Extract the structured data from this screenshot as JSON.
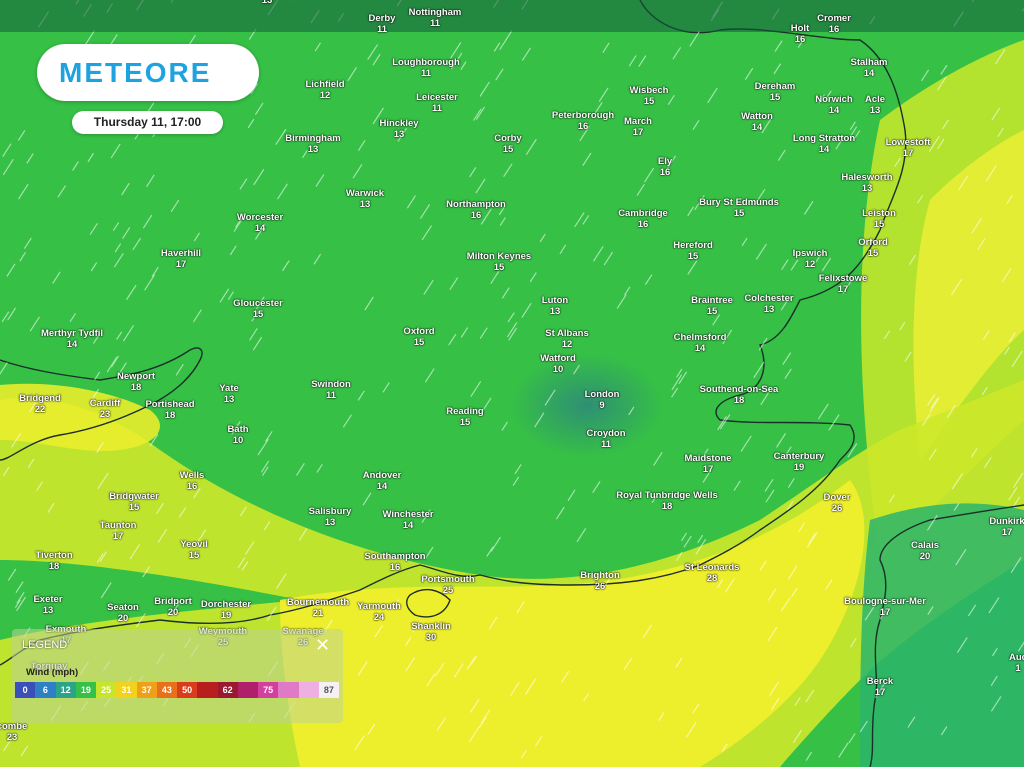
{
  "brand": {
    "logo_text": "METEORE"
  },
  "forecast": {
    "time_label": "Thursday 11, 17:00"
  },
  "legend": {
    "title": "LEGEND",
    "unit_label": "Wind (mph)",
    "close_icon": "close-icon",
    "stops": [
      {
        "label": "0",
        "color": "#3a4fb8"
      },
      {
        "label": "6",
        "color": "#2f7fc4"
      },
      {
        "label": "12",
        "color": "#2ba48a"
      },
      {
        "label": "19",
        "color": "#35c048"
      },
      {
        "label": "25",
        "color": "#c7e62b"
      },
      {
        "label": "31",
        "color": "#f2d21b"
      },
      {
        "label": "37",
        "color": "#f0a018"
      },
      {
        "label": "43",
        "color": "#e8701a"
      },
      {
        "label": "50",
        "color": "#d93b1c"
      },
      {
        "label": "",
        "color": "#b81e1e"
      },
      {
        "label": "62",
        "color": "#9a1830"
      },
      {
        "label": "",
        "color": "#b0206a"
      },
      {
        "label": "75",
        "color": "#d33f9c"
      },
      {
        "label": "",
        "color": "#e07ac6"
      },
      {
        "label": "",
        "color": "#eeb0e0"
      },
      {
        "label": "87",
        "color": "#f5f0f5"
      }
    ]
  },
  "places": [
    {
      "name": "",
      "value": "13"
    },
    {
      "name": "Derby",
      "value": "11"
    },
    {
      "name": "Nottingham",
      "value": "11"
    },
    {
      "name": "Holt",
      "value": "16"
    },
    {
      "name": "Cromer",
      "value": "16"
    },
    {
      "name": "Lichfield",
      "value": "12"
    },
    {
      "name": "Loughborough",
      "value": "11"
    },
    {
      "name": "Leicester",
      "value": "11"
    },
    {
      "name": "Stalham",
      "value": "14"
    },
    {
      "name": "Dereham",
      "value": "15"
    },
    {
      "name": "Wisbech",
      "value": "15"
    },
    {
      "name": "Norwich",
      "value": "14"
    },
    {
      "name": "Acle",
      "value": "13"
    },
    {
      "name": "Peterborough",
      "value": "16"
    },
    {
      "name": "March",
      "value": "17"
    },
    {
      "name": "Watton",
      "value": "14"
    },
    {
      "name": "Hinckley",
      "value": "13"
    },
    {
      "name": "Birmingham",
      "value": "13"
    },
    {
      "name": "Corby",
      "value": "15"
    },
    {
      "name": "Long Stratton",
      "value": "14"
    },
    {
      "name": "Lowestoft",
      "value": "17"
    },
    {
      "name": "Ely",
      "value": "16"
    },
    {
      "name": "Halesworth",
      "value": "13"
    },
    {
      "name": "Warwick",
      "value": "13"
    },
    {
      "name": "Bury St Edmunds",
      "value": "15"
    },
    {
      "name": "Northampton",
      "value": "16"
    },
    {
      "name": "Worcester",
      "value": "14"
    },
    {
      "name": "Cambridge",
      "value": "16"
    },
    {
      "name": "Leiston",
      "value": "15"
    },
    {
      "name": "Orford",
      "value": "15"
    },
    {
      "name": "Haverhill",
      "value": "17"
    },
    {
      "name": "Hereford",
      "value": "15"
    },
    {
      "name": "Ipswich",
      "value": "12"
    },
    {
      "name": "Milton Keynes",
      "value": "15"
    },
    {
      "name": "Felixstowe",
      "value": "17"
    },
    {
      "name": "Luton",
      "value": "13"
    },
    {
      "name": "Braintree",
      "value": "15"
    },
    {
      "name": "Colchester",
      "value": "13"
    },
    {
      "name": "Gloucester",
      "value": "15"
    },
    {
      "name": "Merthyr Tydfil",
      "value": "14"
    },
    {
      "name": "Oxford",
      "value": "15"
    },
    {
      "name": "St Albans",
      "value": "12"
    },
    {
      "name": "Chelmsford",
      "value": "14"
    },
    {
      "name": "Watford",
      "value": "10"
    },
    {
      "name": "Newport",
      "value": "18"
    },
    {
      "name": "Yate",
      "value": "13"
    },
    {
      "name": "Swindon",
      "value": "11"
    },
    {
      "name": "London",
      "value": "9"
    },
    {
      "name": "Southend-on-Sea",
      "value": "18"
    },
    {
      "name": "Bridgend",
      "value": "22"
    },
    {
      "name": "Cardiff",
      "value": "23"
    },
    {
      "name": "Portishead",
      "value": "18"
    },
    {
      "name": "Reading",
      "value": "15"
    },
    {
      "name": "Bath",
      "value": "10"
    },
    {
      "name": "Croydon",
      "value": "11"
    },
    {
      "name": "Maidstone",
      "value": "17"
    },
    {
      "name": "Canterbury",
      "value": "19"
    },
    {
      "name": "Wells",
      "value": "16"
    },
    {
      "name": "Andover",
      "value": "14"
    },
    {
      "name": "Bridgwater",
      "value": "15"
    },
    {
      "name": "Royal Tunbridge Wells",
      "value": "18"
    },
    {
      "name": "Dover",
      "value": "26"
    },
    {
      "name": "Salisbury",
      "value": "13"
    },
    {
      "name": "Winchester",
      "value": "14"
    },
    {
      "name": "Taunton",
      "value": "17"
    },
    {
      "name": "Dunkirk",
      "value": "17"
    },
    {
      "name": "Yeovil",
      "value": "15"
    },
    {
      "name": "Calais",
      "value": "20"
    },
    {
      "name": "Tiverton",
      "value": "18"
    },
    {
      "name": "Southampton",
      "value": "16"
    },
    {
      "name": "St Leonards",
      "value": "28"
    },
    {
      "name": "Brighton",
      "value": "26"
    },
    {
      "name": "Portsmouth",
      "value": "25"
    },
    {
      "name": "Bridport",
      "value": "20"
    },
    {
      "name": "Exeter",
      "value": "13"
    },
    {
      "name": "Seaton",
      "value": "20"
    },
    {
      "name": "Dorchester",
      "value": "19"
    },
    {
      "name": "Bournemouth",
      "value": "21"
    },
    {
      "name": "Boulogne-sur-Mer",
      "value": "17"
    },
    {
      "name": "Yarmouth",
      "value": "24"
    },
    {
      "name": "Exmouth",
      "value": "17"
    },
    {
      "name": "Weymouth",
      "value": "25"
    },
    {
      "name": "Swanage",
      "value": "26"
    },
    {
      "name": "Shanklin",
      "value": "30"
    },
    {
      "name": "Torquay",
      "value": ""
    },
    {
      "name": "Auc",
      "value": "1"
    },
    {
      "name": "Berck",
      "value": "17"
    },
    {
      "name": "combe",
      "value": "23"
    }
  ]
}
